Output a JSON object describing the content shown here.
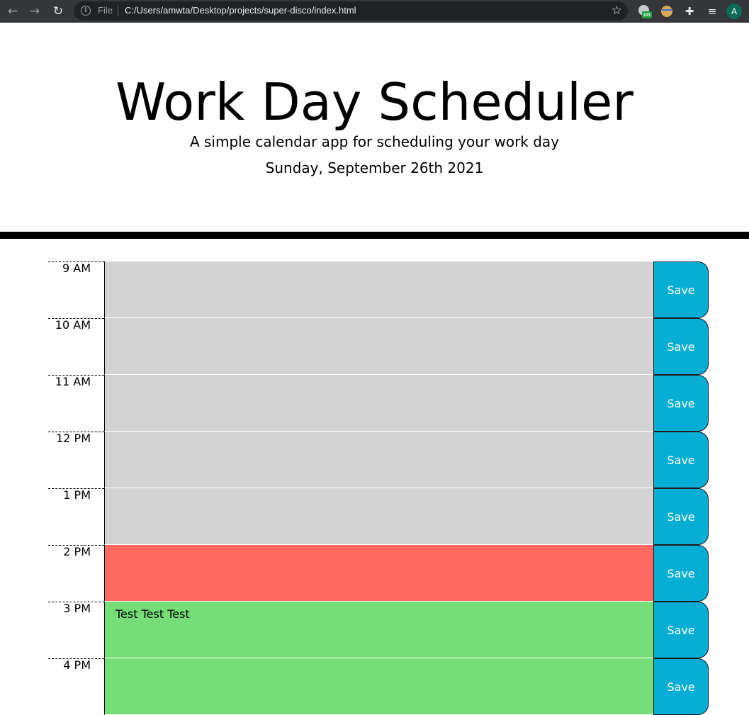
{
  "browser": {
    "file_label": "File",
    "url": "C:/Users/amwta/Desktop/projects/super-disco/index.html",
    "extension_badge": "on",
    "avatar_letter": "A"
  },
  "header": {
    "title": "Work Day Scheduler",
    "lead": "A simple calendar app for scheduling your work day",
    "current_day": "Sunday, September 26th 2021"
  },
  "timeblocks": [
    {
      "hour": "9 AM",
      "text": "",
      "status": "past",
      "save_label": "Save"
    },
    {
      "hour": "10 AM",
      "text": "",
      "status": "past",
      "save_label": "Save"
    },
    {
      "hour": "11 AM",
      "text": "",
      "status": "past",
      "save_label": "Save"
    },
    {
      "hour": "12 PM",
      "text": "",
      "status": "past",
      "save_label": "Save"
    },
    {
      "hour": "1 PM",
      "text": "",
      "status": "past",
      "save_label": "Save"
    },
    {
      "hour": "2 PM",
      "text": "",
      "status": "present",
      "save_label": "Save"
    },
    {
      "hour": "3 PM",
      "text": "Test Test Test",
      "status": "future",
      "save_label": "Save"
    },
    {
      "hour": "4 PM",
      "text": "",
      "status": "future",
      "save_label": "Save"
    }
  ],
  "colors": {
    "past": "#d3d3d3",
    "present": "#ff6961",
    "future": "#77dd77",
    "save": "#06aed5"
  }
}
